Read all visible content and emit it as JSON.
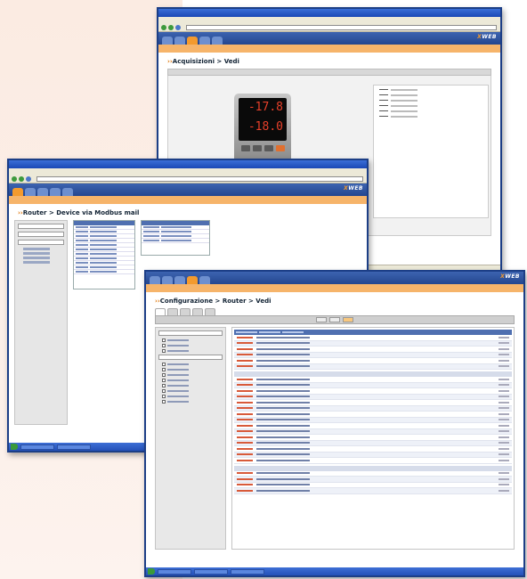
{
  "windows": {
    "back": {
      "page_title": "Acquisizioni > Vedi",
      "device_readout_top": "-17.8",
      "device_readout_bottom": "-18.0"
    },
    "middle": {
      "page_title": "Router > Device via Modbus mail"
    },
    "front": {
      "page_title": "Configurazione > Router > Vedi"
    }
  },
  "brand": {
    "logo_text": "XWEB",
    "accent_color": "#f39a2e",
    "primary_color": "#24468f"
  },
  "icons": [
    "back-icon",
    "forward-icon",
    "start-icon"
  ]
}
